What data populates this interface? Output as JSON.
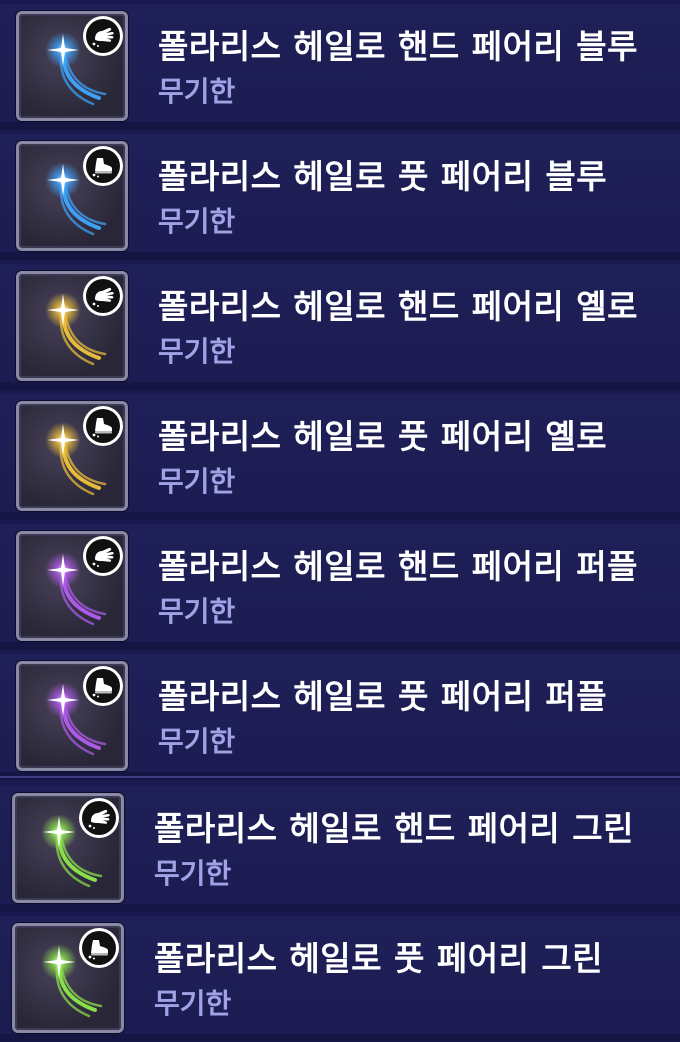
{
  "items": [
    {
      "title": "폴라리스 헤일로 핸드 페어리 블루",
      "duration": "무기한",
      "part_icon": "hand-icon",
      "color": "#3fa6ff"
    },
    {
      "title": "폴라리스 헤일로 풋 페어리 블루",
      "duration": "무기한",
      "part_icon": "shoe-icon",
      "color": "#3fa6ff"
    },
    {
      "title": "폴라리스 헤일로 핸드 페어리 옐로",
      "duration": "무기한",
      "part_icon": "hand-icon",
      "color": "#f2c23a"
    },
    {
      "title": "폴라리스 헤일로 풋 페어리 옐로",
      "duration": "무기한",
      "part_icon": "shoe-icon",
      "color": "#f2c23a"
    },
    {
      "title": "폴라리스 헤일로 핸드 페어리 퍼플",
      "duration": "무기한",
      "part_icon": "hand-icon",
      "color": "#b45cf0"
    },
    {
      "title": "폴라리스 헤일로 풋 페어리 퍼플",
      "duration": "무기한",
      "part_icon": "shoe-icon",
      "color": "#b45cf0"
    },
    {
      "title": "폴라리스 헤일로 핸드 페어리 그린",
      "duration": "무기한",
      "part_icon": "hand-icon",
      "color": "#8ee84a"
    },
    {
      "title": "폴라리스 헤일로 풋 페어리 그린",
      "duration": "무기한",
      "part_icon": "shoe-icon",
      "color": "#8ee84a"
    }
  ]
}
